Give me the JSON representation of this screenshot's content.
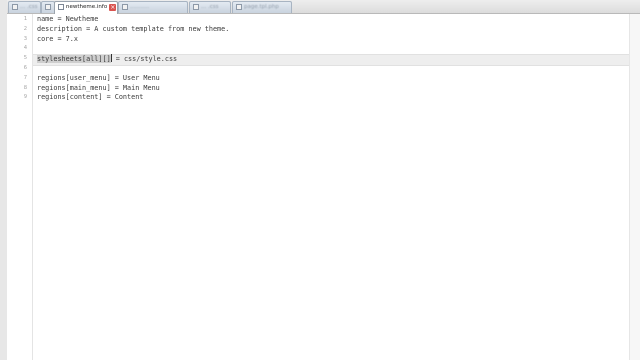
{
  "tabs": [
    {
      "label": "... .css",
      "active": false
    },
    {
      "label": "newtheme.info",
      "active": true
    },
    {
      "label": "...........",
      "active": false
    },
    {
      "label": "... .css",
      "active": false
    },
    {
      "label": "page.tpl.php",
      "active": false
    }
  ],
  "line_numbers": [
    "1",
    "2",
    "3",
    "4",
    "5",
    "6",
    "7",
    "8",
    "9"
  ],
  "code_lines": [
    "name = Newtheme",
    "description = A custom template from new theme.",
    "core = 7.x",
    "",
    {
      "sel": "stylesheets[all][]",
      "rest": " = css/style.css"
    },
    "",
    "regions[user_menu] = User Menu",
    "regions[main_menu] = Main Menu",
    "regions[content] = Content"
  ],
  "colors": {
    "selection": "#cfcfcf",
    "current_line": "#eeeeee",
    "close_icon": "#d9534f"
  },
  "icons": {
    "tab_file": "file-icon",
    "tab_close": "close-icon"
  }
}
